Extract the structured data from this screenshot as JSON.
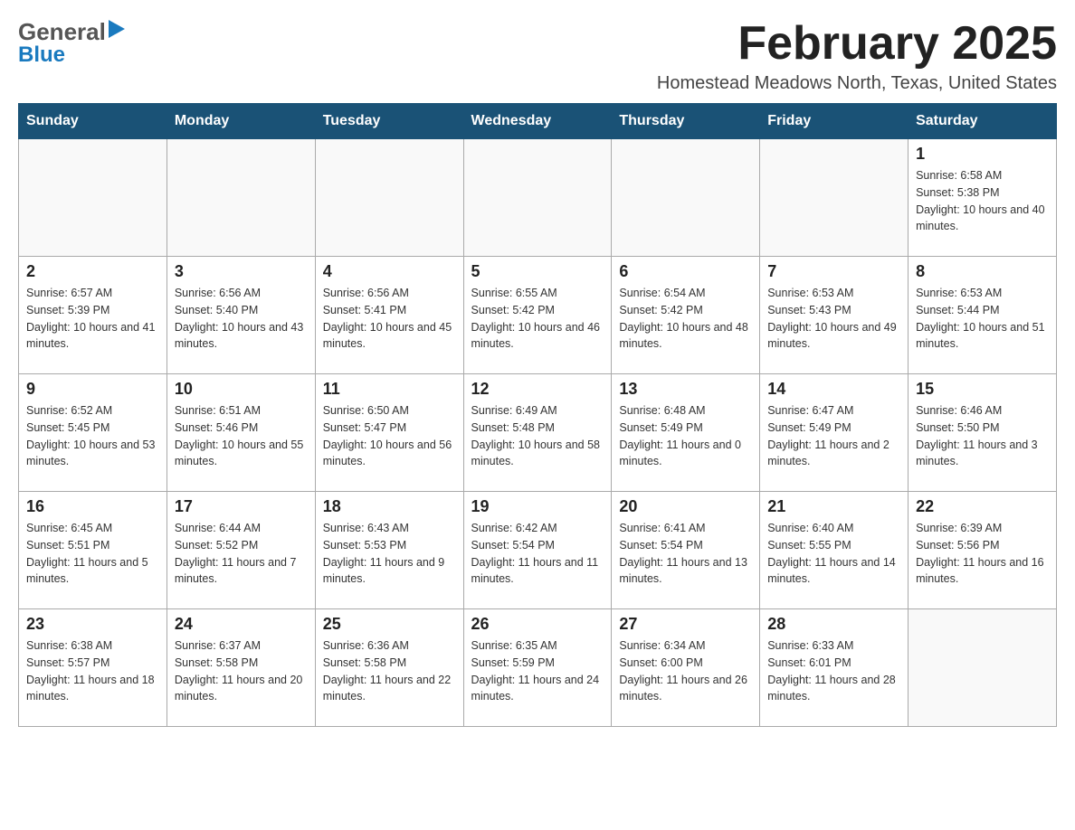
{
  "logo": {
    "line1": "General",
    "arrow": "▶",
    "line2": "Blue"
  },
  "header": {
    "month_title": "February 2025",
    "location": "Homestead Meadows North, Texas, United States"
  },
  "days_of_week": [
    "Sunday",
    "Monday",
    "Tuesday",
    "Wednesday",
    "Thursday",
    "Friday",
    "Saturday"
  ],
  "weeks": [
    [
      {
        "day": "",
        "info": ""
      },
      {
        "day": "",
        "info": ""
      },
      {
        "day": "",
        "info": ""
      },
      {
        "day": "",
        "info": ""
      },
      {
        "day": "",
        "info": ""
      },
      {
        "day": "",
        "info": ""
      },
      {
        "day": "1",
        "info": "Sunrise: 6:58 AM\nSunset: 5:38 PM\nDaylight: 10 hours and 40 minutes."
      }
    ],
    [
      {
        "day": "2",
        "info": "Sunrise: 6:57 AM\nSunset: 5:39 PM\nDaylight: 10 hours and 41 minutes."
      },
      {
        "day": "3",
        "info": "Sunrise: 6:56 AM\nSunset: 5:40 PM\nDaylight: 10 hours and 43 minutes."
      },
      {
        "day": "4",
        "info": "Sunrise: 6:56 AM\nSunset: 5:41 PM\nDaylight: 10 hours and 45 minutes."
      },
      {
        "day": "5",
        "info": "Sunrise: 6:55 AM\nSunset: 5:42 PM\nDaylight: 10 hours and 46 minutes."
      },
      {
        "day": "6",
        "info": "Sunrise: 6:54 AM\nSunset: 5:42 PM\nDaylight: 10 hours and 48 minutes."
      },
      {
        "day": "7",
        "info": "Sunrise: 6:53 AM\nSunset: 5:43 PM\nDaylight: 10 hours and 49 minutes."
      },
      {
        "day": "8",
        "info": "Sunrise: 6:53 AM\nSunset: 5:44 PM\nDaylight: 10 hours and 51 minutes."
      }
    ],
    [
      {
        "day": "9",
        "info": "Sunrise: 6:52 AM\nSunset: 5:45 PM\nDaylight: 10 hours and 53 minutes."
      },
      {
        "day": "10",
        "info": "Sunrise: 6:51 AM\nSunset: 5:46 PM\nDaylight: 10 hours and 55 minutes."
      },
      {
        "day": "11",
        "info": "Sunrise: 6:50 AM\nSunset: 5:47 PM\nDaylight: 10 hours and 56 minutes."
      },
      {
        "day": "12",
        "info": "Sunrise: 6:49 AM\nSunset: 5:48 PM\nDaylight: 10 hours and 58 minutes."
      },
      {
        "day": "13",
        "info": "Sunrise: 6:48 AM\nSunset: 5:49 PM\nDaylight: 11 hours and 0 minutes."
      },
      {
        "day": "14",
        "info": "Sunrise: 6:47 AM\nSunset: 5:49 PM\nDaylight: 11 hours and 2 minutes."
      },
      {
        "day": "15",
        "info": "Sunrise: 6:46 AM\nSunset: 5:50 PM\nDaylight: 11 hours and 3 minutes."
      }
    ],
    [
      {
        "day": "16",
        "info": "Sunrise: 6:45 AM\nSunset: 5:51 PM\nDaylight: 11 hours and 5 minutes."
      },
      {
        "day": "17",
        "info": "Sunrise: 6:44 AM\nSunset: 5:52 PM\nDaylight: 11 hours and 7 minutes."
      },
      {
        "day": "18",
        "info": "Sunrise: 6:43 AM\nSunset: 5:53 PM\nDaylight: 11 hours and 9 minutes."
      },
      {
        "day": "19",
        "info": "Sunrise: 6:42 AM\nSunset: 5:54 PM\nDaylight: 11 hours and 11 minutes."
      },
      {
        "day": "20",
        "info": "Sunrise: 6:41 AM\nSunset: 5:54 PM\nDaylight: 11 hours and 13 minutes."
      },
      {
        "day": "21",
        "info": "Sunrise: 6:40 AM\nSunset: 5:55 PM\nDaylight: 11 hours and 14 minutes."
      },
      {
        "day": "22",
        "info": "Sunrise: 6:39 AM\nSunset: 5:56 PM\nDaylight: 11 hours and 16 minutes."
      }
    ],
    [
      {
        "day": "23",
        "info": "Sunrise: 6:38 AM\nSunset: 5:57 PM\nDaylight: 11 hours and 18 minutes."
      },
      {
        "day": "24",
        "info": "Sunrise: 6:37 AM\nSunset: 5:58 PM\nDaylight: 11 hours and 20 minutes."
      },
      {
        "day": "25",
        "info": "Sunrise: 6:36 AM\nSunset: 5:58 PM\nDaylight: 11 hours and 22 minutes."
      },
      {
        "day": "26",
        "info": "Sunrise: 6:35 AM\nSunset: 5:59 PM\nDaylight: 11 hours and 24 minutes."
      },
      {
        "day": "27",
        "info": "Sunrise: 6:34 AM\nSunset: 6:00 PM\nDaylight: 11 hours and 26 minutes."
      },
      {
        "day": "28",
        "info": "Sunrise: 6:33 AM\nSunset: 6:01 PM\nDaylight: 11 hours and 28 minutes."
      },
      {
        "day": "",
        "info": ""
      }
    ]
  ]
}
